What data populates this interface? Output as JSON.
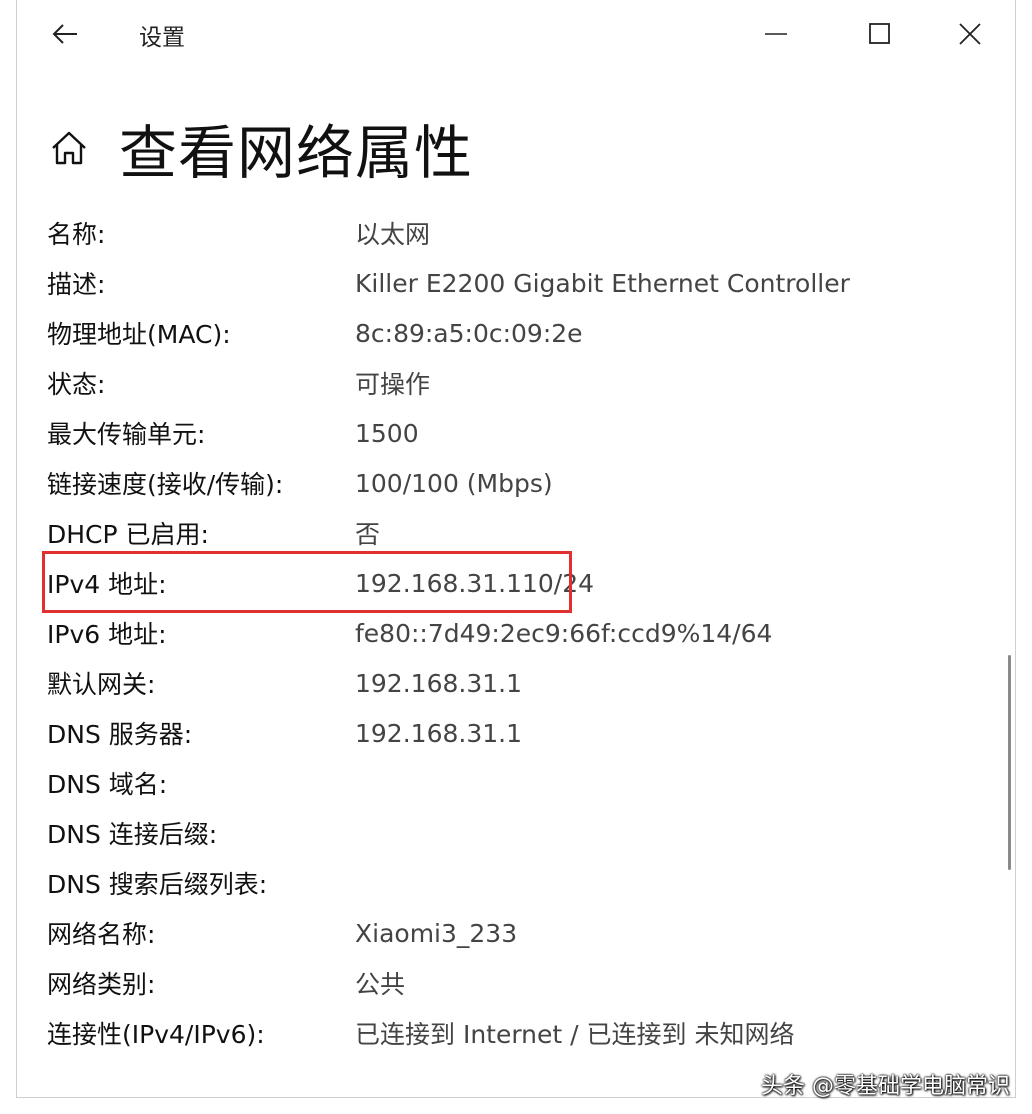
{
  "window": {
    "title": "设置"
  },
  "page": {
    "title": "查看网络属性"
  },
  "properties": [
    {
      "label": "名称:",
      "value": "以太网"
    },
    {
      "label": "描述:",
      "value": "Killer E2200 Gigabit Ethernet Controller"
    },
    {
      "label": "物理地址(MAC):",
      "value": "8c:89:a5:0c:09:2e"
    },
    {
      "label": "状态:",
      "value": "可操作"
    },
    {
      "label": "最大传输单元:",
      "value": "1500"
    },
    {
      "label": "链接速度(接收/传输):",
      "value": "100/100 (Mbps)"
    },
    {
      "label": "DHCP 已启用:",
      "value": "否"
    },
    {
      "label": "IPv4 地址:",
      "value": "192.168.31.110/24"
    },
    {
      "label": "IPv6 地址:",
      "value": "fe80::7d49:2ec9:66f:ccd9%14/64"
    },
    {
      "label": "默认网关:",
      "value": "192.168.31.1"
    },
    {
      "label": "DNS 服务器:",
      "value": "192.168.31.1"
    },
    {
      "label": "DNS 域名:",
      "value": ""
    },
    {
      "label": "DNS 连接后缀:",
      "value": ""
    },
    {
      "label": "DNS 搜索后缀列表:",
      "value": ""
    },
    {
      "label": "网络名称:",
      "value": "Xiaomi3_233"
    },
    {
      "label": "网络类别:",
      "value": "公共"
    },
    {
      "label": "连接性(IPv4/IPv6):",
      "value": "已连接到 Internet / 已连接到 未知网络"
    }
  ],
  "highlight": {
    "color": "#e03030"
  },
  "watermark": "头条 @零基础学电脑常识",
  "icons": {
    "back": "back-arrow-icon",
    "home": "home-icon",
    "minimize": "minimize-icon",
    "maximize": "maximize-icon",
    "close": "close-icon"
  }
}
